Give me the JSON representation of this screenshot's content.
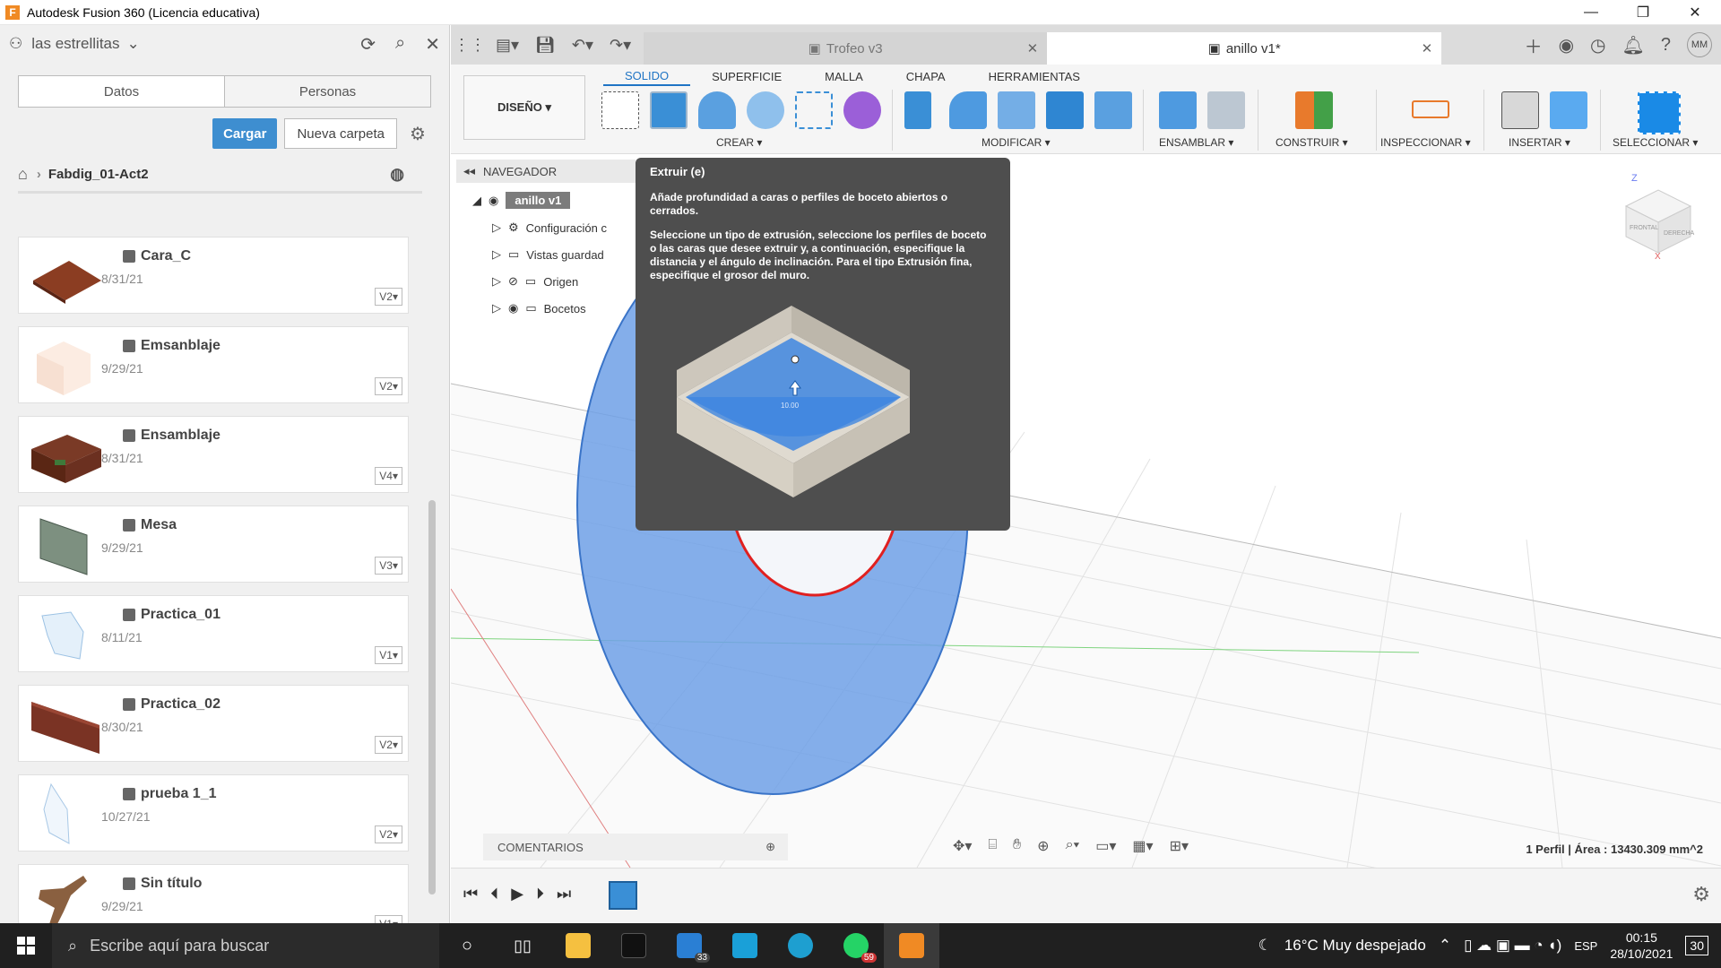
{
  "window": {
    "title": "Autodesk Fusion 360 (Licencia educativa)",
    "logo_letter": "F",
    "minimize": "—",
    "maximize": "❐",
    "close": "✕"
  },
  "data_panel": {
    "team_name": "las estrellitas",
    "tabs": [
      "Datos",
      "Personas"
    ],
    "upload_label": "Cargar",
    "new_folder_label": "Nueva carpeta",
    "folder_name": "Fabdig_01-Act2",
    "files": [
      {
        "name": "Cara_C",
        "date": "8/31/21",
        "version": "V2",
        "thumb_color": "#8b3d22"
      },
      {
        "name": "Emsanblaje",
        "date": "9/29/21",
        "version": "V2",
        "thumb_color": "#fbe8dc"
      },
      {
        "name": "Ensamblaje",
        "date": "8/31/21",
        "version": "V4",
        "thumb_color": "#6b3020"
      },
      {
        "name": "Mesa",
        "date": "9/29/21",
        "version": "V3",
        "thumb_color": "#7d9080"
      },
      {
        "name": "Practica_01",
        "date": "8/11/21",
        "version": "V1",
        "thumb_color": "#d8e8f6"
      },
      {
        "name": "Practica_02",
        "date": "8/30/21",
        "version": "V2",
        "thumb_color": "#7a3324"
      },
      {
        "name": "prueba 1_1",
        "date": "10/27/21",
        "version": "V2",
        "thumb_color": "#e6eef8"
      },
      {
        "name": "Sin título",
        "date": "9/29/21",
        "version": "V1",
        "thumb_color": "#8a6040"
      }
    ]
  },
  "doc_tabs": [
    {
      "label": "Trofeo v3",
      "active": false
    },
    {
      "label": "anillo v1*",
      "active": true
    }
  ],
  "user_initials": "MM",
  "ribbon": {
    "workspace": "DISEÑO ▾",
    "tabs": [
      "SOLIDO",
      "SUPERFICIE",
      "MALLA",
      "CHAPA",
      "HERRAMIENTAS"
    ],
    "groups": [
      "CREAR ▾",
      "MODIFICAR ▾",
      "ENSAMBLAR ▾",
      "CONSTRUIR ▾",
      "INSPECCIONAR ▾",
      "INSERTAR ▾",
      "SELECCIONAR ▾"
    ]
  },
  "navigator": {
    "title": "NAVEGADOR",
    "root": "anillo v1",
    "items": [
      "Configuración c",
      "Vistas guardad",
      "Origen",
      "Bocetos"
    ]
  },
  "tooltip": {
    "title": "Extruir (e)",
    "line1": "Añade profundidad a caras o perfiles de boceto abiertos o cerrados.",
    "line2": "Seleccione un tipo de extrusión, seleccione los perfiles de boceto o las caras que desee extruir y, a continuación, especifique la distancia y el ángulo de inclinación. Para el tipo Extrusión fina, especifique el grosor del muro.",
    "dim_value": "10.00"
  },
  "viewcube": {
    "front": "FRONTAL",
    "right": "DERECHA",
    "z": "Z",
    "x": "X"
  },
  "comments_label": "COMENTARIOS",
  "status_text": "1 Perfil | Área : 13430.309 mm^2",
  "taskbar": {
    "search_placeholder": "Escribe aquí para buscar",
    "weather": "16°C  Muy despejado",
    "lang": "ESP",
    "time": "00:15",
    "date": "28/10/2021",
    "notif_count": "30",
    "badge_teams": "33",
    "badge_whatsapp": "59"
  }
}
